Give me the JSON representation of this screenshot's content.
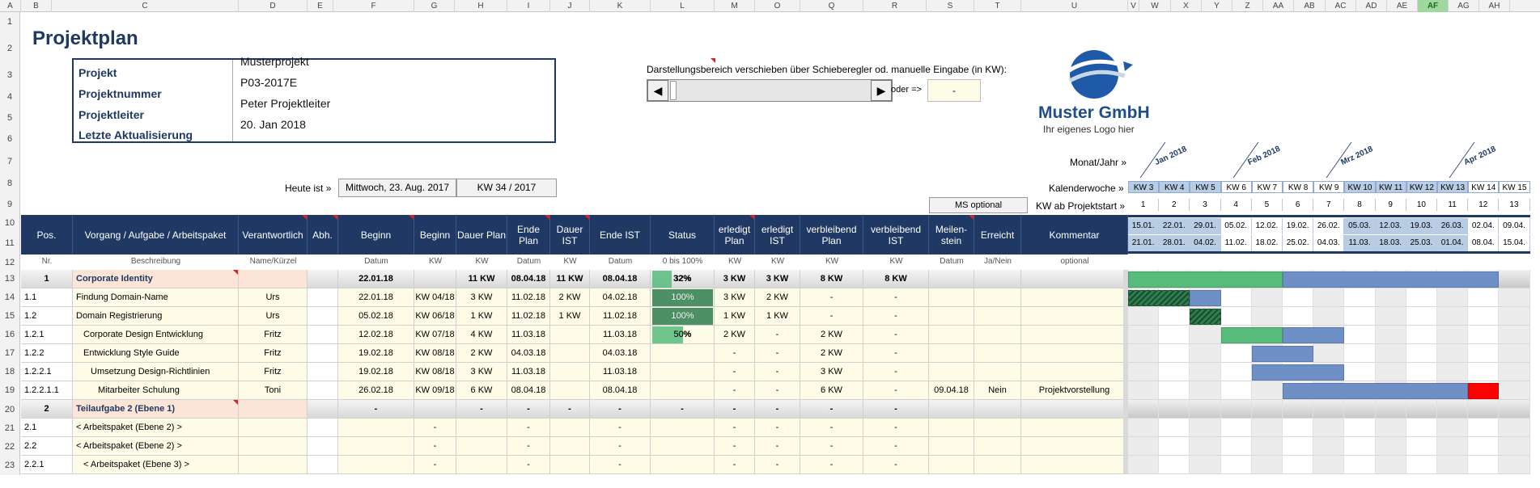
{
  "colors": {
    "navy": "#1f3864",
    "green": "#57bb7c",
    "darkgreen": "#2e7d4f",
    "ganttblue": "#6f8fc7",
    "red": "#ff0000"
  },
  "col_letters": [
    "A",
    "B",
    "C",
    "D",
    "E",
    "F",
    "G",
    "H",
    "I",
    "J",
    "K",
    "L",
    "M",
    "O",
    "Q",
    "R",
    "S",
    "T",
    "U",
    "V",
    "W",
    "X",
    "Y",
    "Z",
    "AA",
    "AB",
    "AC",
    "AD",
    "AE",
    "AF",
    "AG",
    "AH"
  ],
  "row_numbers": [
    "1",
    "2",
    "3",
    "4",
    "5",
    "6",
    "7",
    "8",
    "9",
    "10",
    "11",
    "12",
    "13",
    "14",
    "15",
    "16",
    "17",
    "18",
    "19",
    "20",
    "21",
    "22",
    "23"
  ],
  "title": "Projektplan",
  "project": {
    "labels": [
      "Projekt",
      "Projektnummer",
      "Projektleiter",
      "Letzte Aktualisierung"
    ],
    "values": [
      "Musterprojekt",
      "P03-2017E",
      "Peter Projektleiter",
      "20. Jan 2018"
    ]
  },
  "slider": {
    "label": "Darstellungsbereich verschieben über Schieberegler od. manuelle Eingabe (in KW):",
    "oder": "oder =>",
    "value": "-",
    "left_arrow": "◀",
    "right_arrow": "▶"
  },
  "logo": {
    "name": "Muster GmbH",
    "tagline": "Ihr eigenes Logo hier"
  },
  "today": {
    "label": "Heute ist »",
    "date": "Mittwoch, 23. Aug. 2017",
    "kw": "KW 34 / 2017"
  },
  "gantt_labels": {
    "month": "Monat/Jahr »",
    "week": "Kalenderwoche »",
    "since": "KW ab Projektstart »",
    "ms_optional": "MS optional"
  },
  "months": [
    "Jan 2018",
    "Feb 2018",
    "Mrz 2018",
    "Apr 2018"
  ],
  "weeks": [
    "KW 3",
    "KW 4",
    "KW 5",
    "KW 6",
    "KW 7",
    "KW 8",
    "KW 9",
    "KW 10",
    "KW 11",
    "KW 12",
    "KW 13",
    "KW 14",
    "KW 15"
  ],
  "week_index": [
    "1",
    "2",
    "3",
    "4",
    "5",
    "6",
    "7",
    "8",
    "9",
    "10",
    "11",
    "12",
    "13"
  ],
  "week_start": [
    "15.01.",
    "22.01.",
    "29.01.",
    "05.02.",
    "12.02.",
    "19.02.",
    "26.02.",
    "05.03.",
    "12.03.",
    "19.03.",
    "26.03.",
    "02.04.",
    "09.04."
  ],
  "week_end": [
    "21.01.",
    "28.01.",
    "04.02.",
    "11.02.",
    "18.02.",
    "25.02.",
    "04.03.",
    "11.03.",
    "18.03.",
    "25.03.",
    "01.04.",
    "08.04.",
    "15.04."
  ],
  "headers": [
    "Pos.",
    "Vorgang / Aufgabe / Arbeitspaket",
    "Verantwortlich",
    "Abh.",
    "Beginn",
    "Beginn",
    "Dauer Plan",
    "Ende Plan",
    "Dauer IST",
    "Ende IST",
    "Status",
    "erledigt Plan",
    "erledigt IST",
    "verbleibend Plan",
    "verbleibend IST",
    "Meilen-stein",
    "Erreicht",
    "Kommentar"
  ],
  "subheaders": [
    "Nr.",
    "Beschreibung",
    "Name/Kürzel",
    "",
    "Datum",
    "KW",
    "KW",
    "Datum",
    "KW",
    "Datum",
    "0 bis 100%",
    "KW",
    "KW",
    "KW",
    "KW",
    "Datum",
    "Ja/Nein",
    "optional"
  ],
  "rows": [
    {
      "cells": [
        "1",
        "Corporate Identity",
        "",
        "",
        "22.01.18",
        "",
        "11 KW",
        "08.04.18",
        "11 KW",
        "08.04.18",
        "32%",
        "3 KW",
        "3 KW",
        "8 KW",
        "8 KW",
        "",
        "",
        ""
      ],
      "group": true,
      "progress": 0.32
    },
    {
      "cells": [
        "1.1",
        "Findung Domain-Name",
        "Urs",
        "",
        "22.01.18",
        "KW 04/18",
        "3 KW",
        "11.02.18",
        "2 KW",
        "04.02.18",
        "100%",
        "3 KW",
        "2 KW",
        "-",
        "-",
        "",
        "",
        ""
      ],
      "progress": 1.0
    },
    {
      "cells": [
        "1.2",
        "Domain Registrierung",
        "Urs",
        "",
        "05.02.18",
        "KW 06/18",
        "1 KW",
        "11.02.18",
        "1 KW",
        "11.02.18",
        "100%",
        "1 KW",
        "1 KW",
        "-",
        "-",
        "",
        "",
        ""
      ],
      "progress": 1.0
    },
    {
      "cells": [
        "1.2.1",
        "Corporate Design Entwicklung",
        "Fritz",
        "",
        "12.02.18",
        "KW 07/18",
        "4 KW",
        "11.03.18",
        "",
        "11.03.18",
        "50%",
        "2 KW",
        "-",
        "2 KW",
        "-",
        "",
        "",
        ""
      ],
      "progress": 0.5,
      "indent": 1
    },
    {
      "cells": [
        "1.2.2",
        "Entwicklung Style Guide",
        "Fritz",
        "",
        "19.02.18",
        "KW 08/18",
        "2 KW",
        "04.03.18",
        "",
        "04.03.18",
        "",
        "-",
        "-",
        "2 KW",
        "-",
        "",
        "",
        ""
      ],
      "progress": 0,
      "indent": 1
    },
    {
      "cells": [
        "1.2.2.1",
        "Umsetzung Design-Richtlinien",
        "Fritz",
        "",
        "19.02.18",
        "KW 08/18",
        "3 KW",
        "11.03.18",
        "",
        "11.03.18",
        "",
        "-",
        "-",
        "3 KW",
        "-",
        "",
        "",
        ""
      ],
      "progress": 0,
      "indent": 2
    },
    {
      "cells": [
        "1.2.2.1.1",
        "Mitarbeiter Schulung",
        "Toni",
        "",
        "26.02.18",
        "KW 09/18",
        "6 KW",
        "08.04.18",
        "",
        "08.04.18",
        "",
        "-",
        "-",
        "6 KW",
        "-",
        "09.04.18",
        "Nein",
        "Projektvorstellung"
      ],
      "progress": 0,
      "indent": 3
    },
    {
      "cells": [
        "2",
        "Teilaufgabe 2 (Ebene 1)",
        "",
        "",
        "-",
        "",
        "-",
        "-",
        "-",
        "-",
        "-",
        "-",
        "-",
        "-",
        "-",
        "",
        "",
        ""
      ],
      "group": true,
      "progress": 0
    },
    {
      "cells": [
        "2.1",
        "< Arbeitspaket (Ebene 2) >",
        "",
        "",
        "",
        "-",
        "",
        "-",
        "",
        "-",
        "",
        "-",
        "-",
        "-",
        "-",
        "",
        "",
        ""
      ],
      "progress": 0
    },
    {
      "cells": [
        "2.2",
        "< Arbeitspaket (Ebene 2) >",
        "",
        "",
        "",
        "-",
        "",
        "-",
        "",
        "-",
        "",
        "-",
        "-",
        "-",
        "-",
        "",
        "",
        ""
      ],
      "progress": 0
    },
    {
      "cells": [
        "2.2.1",
        "< Arbeitspaket (Ebene 3) >",
        "",
        "",
        "",
        "-",
        "",
        "-",
        "",
        "-",
        "",
        "-",
        "-",
        "-",
        "-",
        "",
        "",
        ""
      ],
      "progress": 0,
      "indent": 1
    }
  ],
  "gantt_rows": [
    {
      "bars": [
        {
          "from": 1,
          "to": 5,
          "color": "green"
        },
        {
          "from": 6,
          "to": 12,
          "color": "blue"
        }
      ]
    },
    {
      "bars": [
        {
          "from": 1,
          "to": 2,
          "color": "hatch"
        },
        {
          "from": 3,
          "to": 3,
          "color": "blue"
        }
      ]
    },
    {
      "bars": [
        {
          "from": 3,
          "to": 3,
          "color": "hatch"
        }
      ]
    },
    {
      "bars": [
        {
          "from": 4,
          "to": 5,
          "color": "green"
        },
        {
          "from": 6,
          "to": 7,
          "color": "blue"
        }
      ]
    },
    {
      "bars": [
        {
          "from": 5,
          "to": 6,
          "color": "blue"
        }
      ]
    },
    {
      "bars": [
        {
          "from": 5,
          "to": 7,
          "color": "blue"
        }
      ]
    },
    {
      "bars": [
        {
          "from": 6,
          "to": 11,
          "color": "blue"
        },
        {
          "from": 12,
          "to": 12,
          "color": "red"
        }
      ]
    },
    {
      "bars": []
    },
    {
      "bars": []
    },
    {
      "bars": []
    },
    {
      "bars": []
    }
  ]
}
